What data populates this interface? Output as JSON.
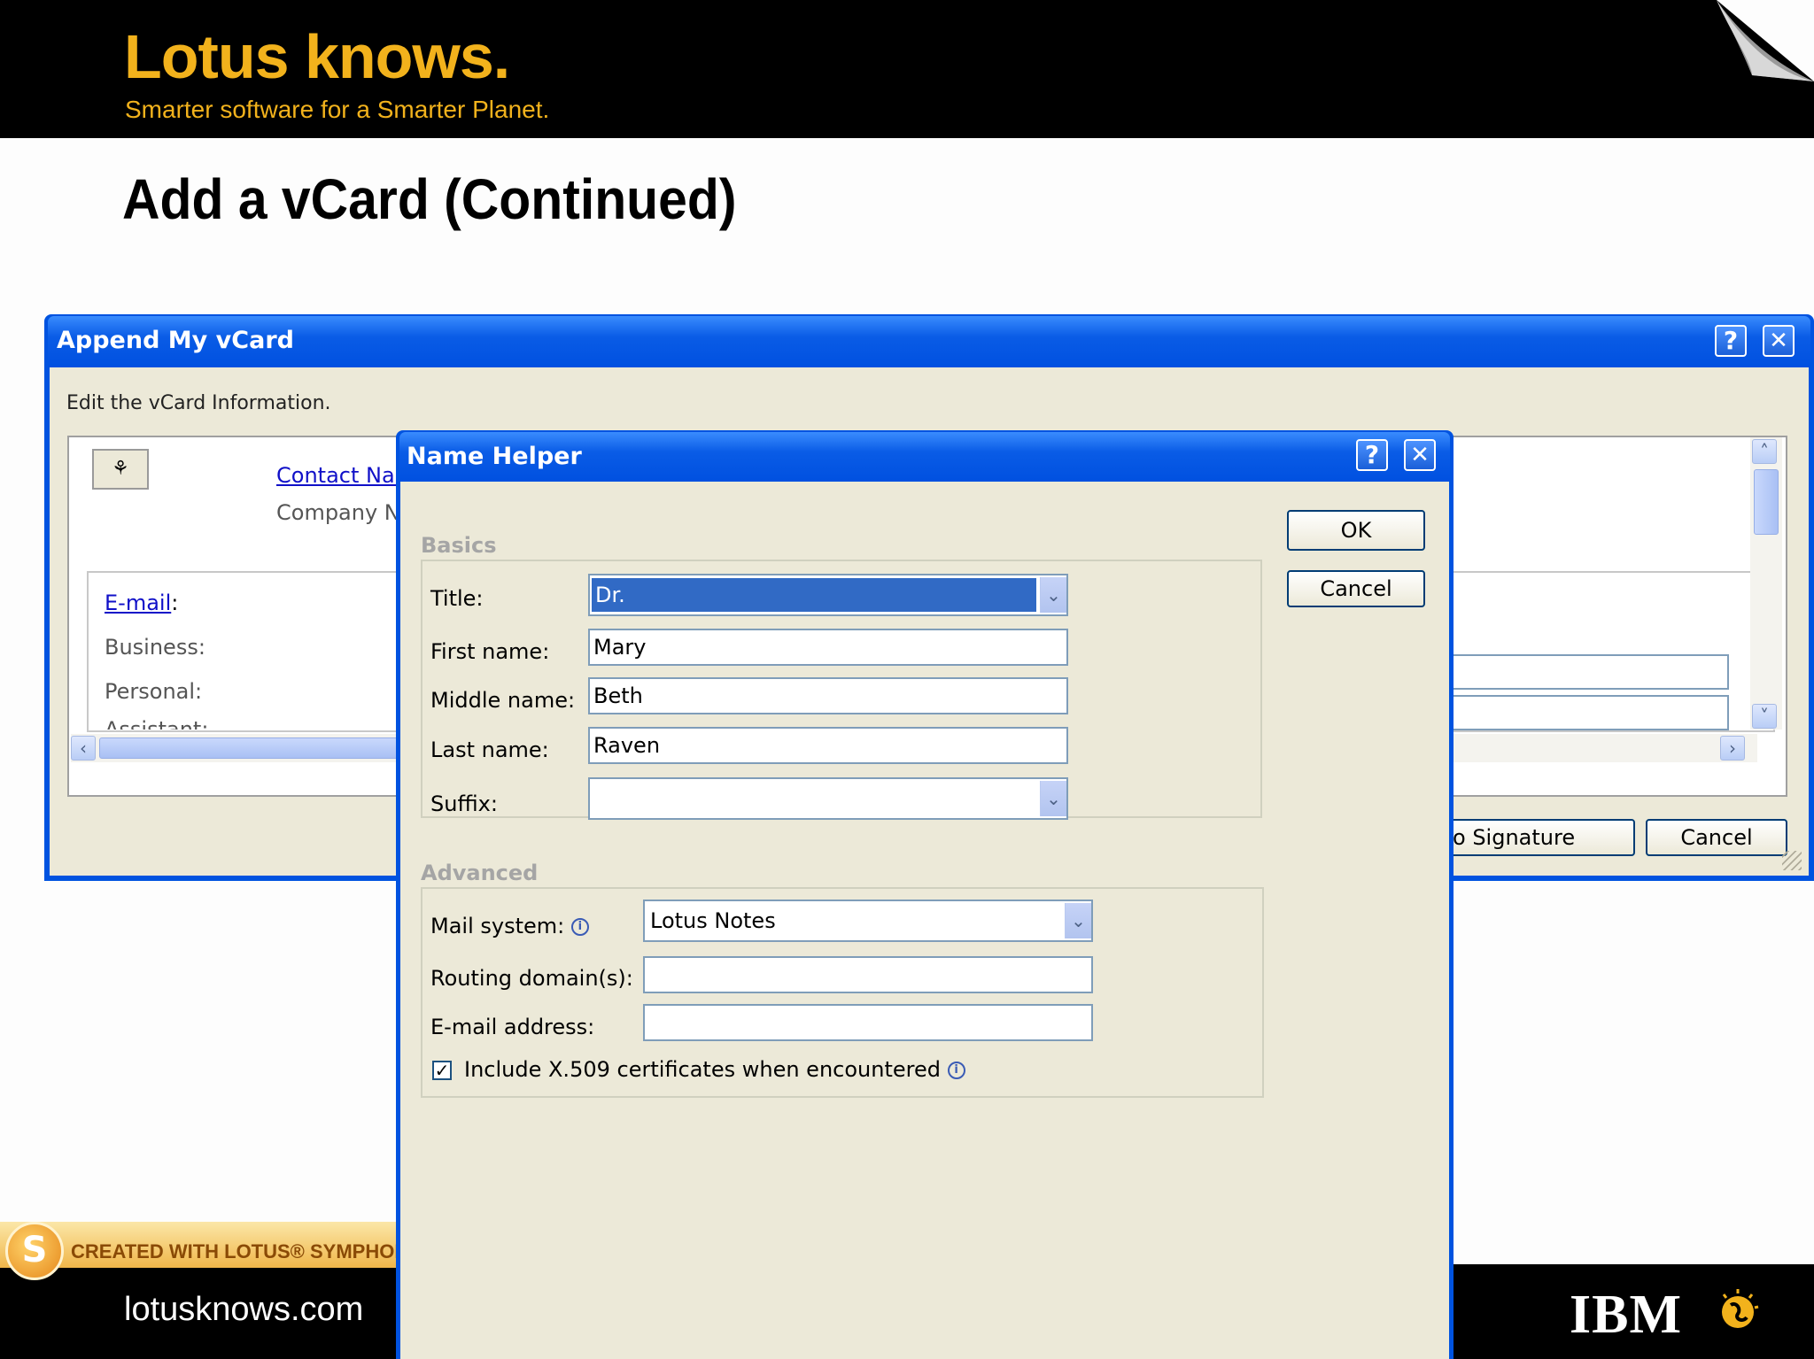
{
  "slide": {
    "brand": "Lotus knows.",
    "tagline": "Smarter software for a Smarter Planet.",
    "title": "Add a vCard (Continued)",
    "footer_url": "lotusknows.com",
    "symphony_badge": "CREATED WITH LOTUS® SYMPHONY™",
    "footer_logo": "IBM"
  },
  "append_dialog": {
    "title": "Append My vCard",
    "help_btn": "?",
    "close_btn": "✕",
    "instruction": "Edit the vCard Information.",
    "contact_name_link": "Contact Nar",
    "company_label": "Company N",
    "email_link": "E-mail",
    "email_colon": ":",
    "business_label": "Business:",
    "personal_label": "Personal:",
    "assistant_label": "Assistant:",
    "signature_btn": "o Signature",
    "cancel_btn": "Cancel"
  },
  "name_helper": {
    "title": "Name Helper",
    "help_btn": "?",
    "close_btn": "✕",
    "ok_btn": "OK",
    "cancel_btn": "Cancel",
    "basics_heading": "Basics",
    "title_label": "Title:",
    "title_value": "Dr.",
    "first_label": "First name:",
    "first_value": "Mary",
    "middle_label": "Middle name:",
    "middle_value": "Beth",
    "last_label": "Last name:",
    "last_value": "Raven",
    "suffix_label": "Suffix:",
    "suffix_value": "",
    "advanced_heading": "Advanced",
    "mail_system_label": "Mail system:",
    "mail_system_value": "Lotus Notes",
    "routing_label": "Routing domain(s):",
    "routing_value": "",
    "email_label": "E-mail address:",
    "email_value": "",
    "x509_label": "Include X.509 certificates when encountered",
    "x509_checked": true
  },
  "colors": {
    "brand_yellow": "#f2b21c",
    "xp_blue": "#0053e0",
    "dialog_face": "#ece9d8",
    "selection": "#316ac5"
  }
}
